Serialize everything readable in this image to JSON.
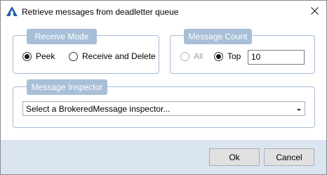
{
  "window": {
    "title": "Retrieve messages from deadletter queue"
  },
  "receive_mode": {
    "label": "Receive Mode",
    "options": [
      {
        "label": "Peek",
        "selected": true
      },
      {
        "label": "Receive and Delete",
        "selected": false
      }
    ]
  },
  "message_count": {
    "label": "Message Count",
    "all_label": "All",
    "all_selected": false,
    "all_enabled": false,
    "top_label": "Top",
    "top_selected": true,
    "top_value": "10"
  },
  "message_inspector": {
    "label": "Message Inspector",
    "selected_value": "Select a BrokeredMessage inspector..."
  },
  "buttons": {
    "ok": "Ok",
    "cancel": "Cancel"
  },
  "colors": {
    "group_border": "#a3bcd6",
    "group_label_bg": "#a8bfd8",
    "footer_bg": "#dae5f1",
    "accent": "#1f5fa6"
  }
}
